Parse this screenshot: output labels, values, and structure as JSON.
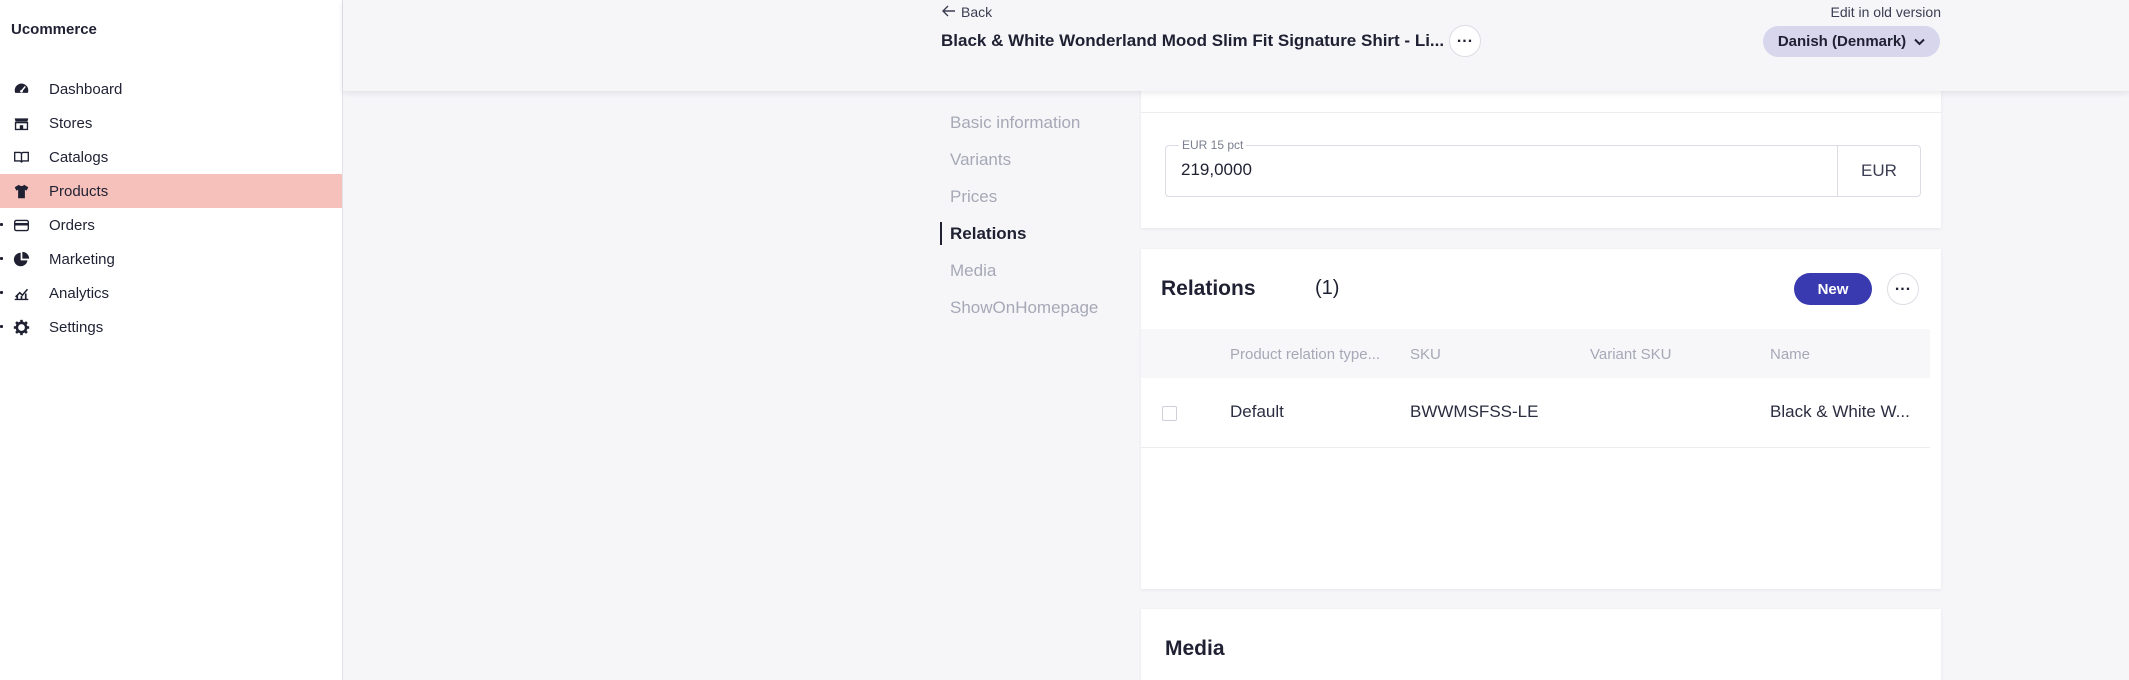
{
  "app": {
    "brand": "Ucommerce"
  },
  "sidebar": {
    "items": [
      {
        "label": "Dashboard",
        "icon": "dashboard-icon",
        "caret": false
      },
      {
        "label": "Stores",
        "icon": "store-icon",
        "caret": false
      },
      {
        "label": "Catalogs",
        "icon": "catalog-icon",
        "caret": false
      },
      {
        "label": "Products",
        "icon": "shirt-icon",
        "caret": false,
        "active": true
      },
      {
        "label": "Orders",
        "icon": "orders-icon",
        "caret": true
      },
      {
        "label": "Marketing",
        "icon": "marketing-icon",
        "caret": true
      },
      {
        "label": "Analytics",
        "icon": "analytics-icon",
        "caret": true
      },
      {
        "label": "Settings",
        "icon": "gear-icon",
        "caret": true
      }
    ]
  },
  "header": {
    "back_label": "Back",
    "title": "Black & White Wonderland Mood Slim Fit Signature Shirt - Li...",
    "edit_old_label": "Edit in old version",
    "language": "Danish (Denmark)"
  },
  "section_nav": {
    "items": [
      {
        "label": "Basic information"
      },
      {
        "label": "Variants"
      },
      {
        "label": "Prices"
      },
      {
        "label": "Relations",
        "active": true
      },
      {
        "label": "Media"
      },
      {
        "label": "ShowOnHomepage"
      }
    ]
  },
  "prices": {
    "field_label": "EUR 15 pct",
    "value": "219,0000",
    "currency": "EUR"
  },
  "relations": {
    "title": "Relations",
    "count": "(1)",
    "new_label": "New",
    "columns": [
      "Product relation type...",
      "SKU",
      "Variant SKU",
      "Name"
    ],
    "rows": [
      {
        "type": "Default",
        "sku": "BWWMSFSS-LE",
        "variant_sku": "",
        "name": "Black & White W..."
      }
    ]
  },
  "media": {
    "title": "Media"
  },
  "colors": {
    "accent": "#3a3ab0",
    "active_nav": "#f6c1bb",
    "language_pill": "#d7d6ec"
  }
}
